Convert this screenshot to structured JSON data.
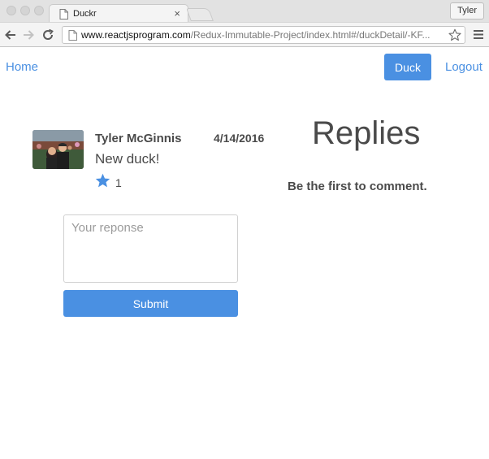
{
  "browser": {
    "tab_title": "Duckr",
    "tab_close": "×",
    "profile_name": "Tyler",
    "url_host": "www.reactjsprogram.com",
    "url_path": "/Redux-Immutable-Project/index.html#/duckDetail/-KF...",
    "icons": {
      "back": "arrow-left-icon",
      "forward": "arrow-right-icon",
      "reload": "reload-icon",
      "bookmark": "star-outline-icon",
      "menu": "hamburger-menu-icon"
    }
  },
  "navbar": {
    "home_label": "Home",
    "duck_button_label": "Duck",
    "logout_label": "Logout"
  },
  "duck": {
    "author": "Tyler McGinnis",
    "date": "4/14/2016",
    "text": "New duck!",
    "like_count": "1",
    "like_icon": "star-icon",
    "avatar_icon": "user-photo"
  },
  "replies": {
    "title": "Replies",
    "empty_message": "Be the first to comment."
  },
  "reply_form": {
    "placeholder": "Your reponse",
    "value": "",
    "submit_label": "Submit"
  },
  "colors": {
    "accent": "#4a90e2",
    "text": "#4a4a4a"
  }
}
